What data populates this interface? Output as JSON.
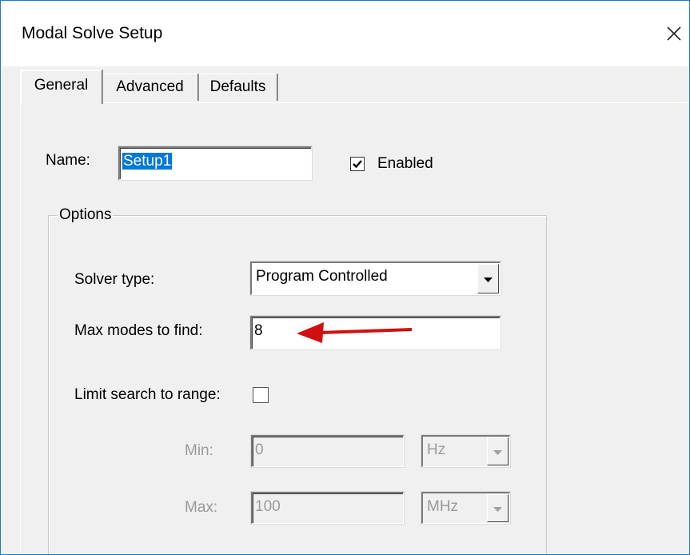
{
  "window": {
    "title": "Modal Solve Setup"
  },
  "tabs": [
    {
      "label": "General",
      "active": true
    },
    {
      "label": "Advanced",
      "active": false
    },
    {
      "label": "Defaults",
      "active": false
    }
  ],
  "general": {
    "name_label": "Name:",
    "name_value": "Setup1",
    "enabled_label": "Enabled",
    "enabled_checked": true,
    "options": {
      "group_label": "Options",
      "solver_type_label": "Solver type:",
      "solver_type_value": "Program Controlled",
      "max_modes_label": "Max modes to find:",
      "max_modes_value": "8",
      "limit_search_label": "Limit search to range:",
      "limit_search_checked": false,
      "min_label": "Min:",
      "min_value": "0",
      "min_unit": "Hz",
      "max_label": "Max:",
      "max_value": "100",
      "max_unit": "MHz"
    }
  },
  "annotation": {
    "arrow_color": "#d01010"
  },
  "colors": {
    "selection": "#0078d7",
    "window_border": "#1e78c8"
  },
  "icons": {
    "close": "close-icon",
    "dropdown": "chevron-down-icon",
    "check": "checkmark-icon"
  }
}
